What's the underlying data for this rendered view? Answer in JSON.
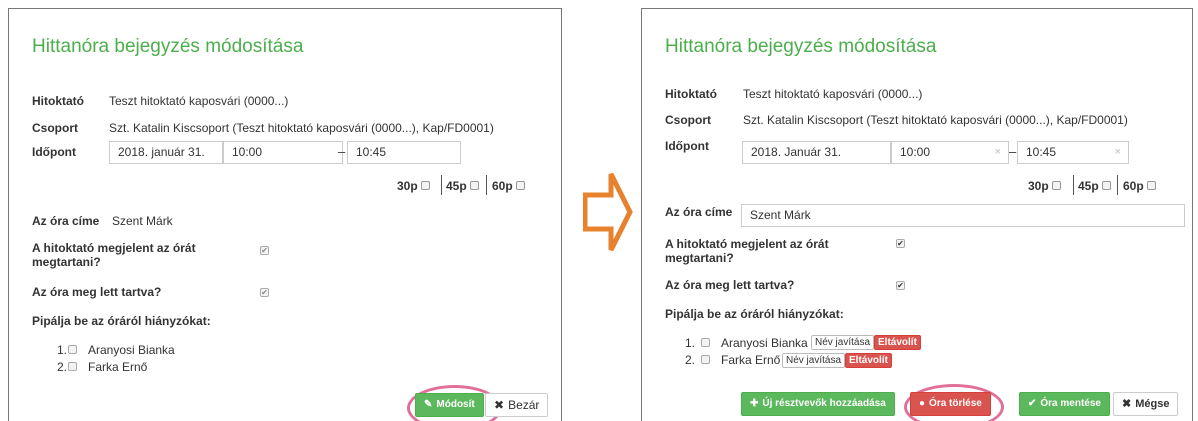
{
  "left": {
    "title": "Hittanóra bejegyzés módosítása",
    "hitoktato_label": "Hitoktató",
    "hitoktato_value": "Teszt hitoktató kaposvári (0000...)",
    "csoport_label": "Csoport",
    "csoport_value": "Szt. Katalin Kiscsoport (Teszt hitoktató kaposvári (0000...), Kap/FD0001)",
    "idopont_label": "Időpont",
    "date_value": "2018. január 31.",
    "start_value": "10:00",
    "dash": "–",
    "end_value": "10:45",
    "dur30": "30p",
    "dur45": "45p",
    "dur60": "60p",
    "ora_cime_label": "Az óra címe",
    "ora_cime_value": "Szent Márk",
    "megjelent_label": "A hitoktató megjelent az órát megtartani?",
    "megtartva_label": "Az óra meg lett tartva?",
    "hianyzok_label": "Pipálja be az óráról hiányzókat:",
    "students": [
      {
        "num": "1.",
        "name": "Aranyosi Bianka"
      },
      {
        "num": "2.",
        "name": "Farka Ernő"
      }
    ],
    "modosit_button": "Módosít",
    "bezar_button": "Bezár"
  },
  "right": {
    "title": "Hittanóra bejegyzés módosítása",
    "hitoktato_label": "Hitoktató",
    "hitoktato_value": "Teszt hitoktató kaposvári (0000...)",
    "csoport_label": "Csoport",
    "csoport_value": "Szt. Katalin Kiscsoport (Teszt hitoktató kaposvári (0000...), Kap/FD0001)",
    "idopont_label": "Időpont",
    "date_value": "2018. Január 31.",
    "start_value": "10:00",
    "dash": "–",
    "end_value": "10:45",
    "clear_glyph": "×",
    "dur30": "30p",
    "dur45": "45p",
    "dur60": "60p",
    "ora_cime_label": "Az óra címe",
    "ora_cime_value": "Szent Márk",
    "megjelent_label": "A hitoktató megjelent az órát megtartani?",
    "megtartva_label": "Az óra meg lett tartva?",
    "hianyzok_label": "Pipálja be az óráról hiányzókat:",
    "students": [
      {
        "num": "1.",
        "name": "Aranyosi Bianka",
        "fix": "Név javítása",
        "removed": "Eltávolít"
      },
      {
        "num": "2.",
        "name": "Farka Ernő",
        "fix": "Név javítása",
        "removed": "Eltávolít"
      }
    ],
    "add_button": "Új résztvevők hozzáadása",
    "delete_button": "Óra törlése",
    "save_button": "Óra mentése",
    "cancel_button": "Mégse"
  },
  "colors": {
    "accent_green": "#5cb85c",
    "title_green": "#4cae4c",
    "danger_red": "#d9534f",
    "highlight_ring": "#e0709a",
    "arrow_orange": "#e8822f"
  },
  "icons": {
    "check": "✔",
    "pencil": "✎",
    "close": "✖",
    "plus": "✚",
    "info": "●"
  }
}
